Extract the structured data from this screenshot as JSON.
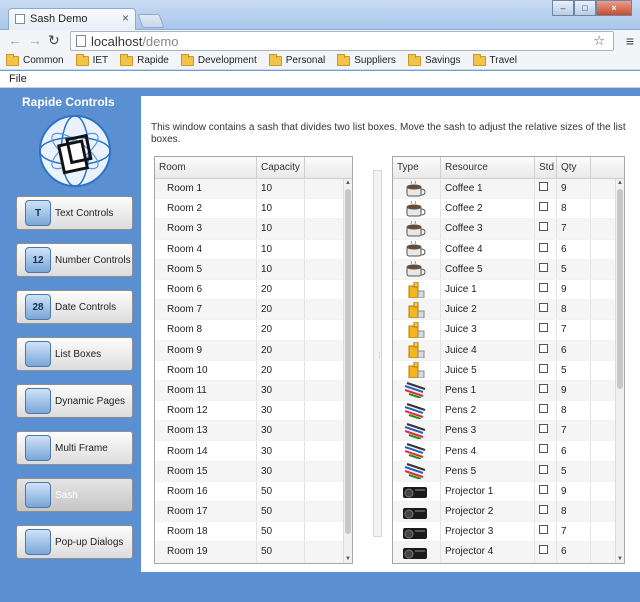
{
  "browser": {
    "tab_title": "Sash Demo",
    "url_host": "localhost",
    "url_path": "/demo",
    "bookmarks": [
      "Common",
      "IET",
      "Rapide",
      "Development",
      "Personal",
      "Suppliers",
      "Savings",
      "Travel"
    ]
  },
  "menubar": {
    "file": "File"
  },
  "sidebar": {
    "title": "Rapide Controls",
    "items": [
      {
        "label": "Text Controls",
        "icon": "T",
        "icon_name": "text-controls-icon"
      },
      {
        "label": "Number Controls",
        "icon": "12",
        "icon_name": "number-controls-icon"
      },
      {
        "label": "Date Controls",
        "icon": "28",
        "icon_name": "date-controls-icon"
      },
      {
        "label": "List Boxes",
        "icon": "",
        "icon_name": "list-boxes-icon"
      },
      {
        "label": "Dynamic Pages",
        "icon": "",
        "icon_name": "dynamic-pages-icon"
      },
      {
        "label": "Multi Frame",
        "icon": "",
        "icon_name": "multi-frame-icon"
      },
      {
        "label": "Sash",
        "icon": "",
        "icon_name": "sash-icon"
      },
      {
        "label": "Pop-up Dialogs",
        "icon": "",
        "icon_name": "popup-dialogs-icon"
      }
    ]
  },
  "main": {
    "description": "This window contains a sash that divides two list boxes. Move the sash to adjust the relative sizes of the list boxes.",
    "rooms": {
      "headers": [
        "Room",
        "Capacity"
      ],
      "rows": [
        [
          "Room 1",
          "10"
        ],
        [
          "Room 2",
          "10"
        ],
        [
          "Room 3",
          "10"
        ],
        [
          "Room 4",
          "10"
        ],
        [
          "Room 5",
          "10"
        ],
        [
          "Room 6",
          "20"
        ],
        [
          "Room 7",
          "20"
        ],
        [
          "Room 8",
          "20"
        ],
        [
          "Room 9",
          "20"
        ],
        [
          "Room 10",
          "20"
        ],
        [
          "Room 11",
          "30"
        ],
        [
          "Room 12",
          "30"
        ],
        [
          "Room 13",
          "30"
        ],
        [
          "Room 14",
          "30"
        ],
        [
          "Room 15",
          "30"
        ],
        [
          "Room 16",
          "50"
        ],
        [
          "Room 17",
          "50"
        ],
        [
          "Room 18",
          "50"
        ],
        [
          "Room 19",
          "50"
        ]
      ]
    },
    "resources": {
      "headers": [
        "Type",
        "Resource",
        "Std",
        "Qty"
      ],
      "rows": [
        {
          "type": "coffee",
          "resource": "Coffee 1",
          "qty": "9"
        },
        {
          "type": "coffee",
          "resource": "Coffee 2",
          "qty": "8"
        },
        {
          "type": "coffee",
          "resource": "Coffee 3",
          "qty": "7"
        },
        {
          "type": "coffee",
          "resource": "Coffee 4",
          "qty": "6"
        },
        {
          "type": "coffee",
          "resource": "Coffee 5",
          "qty": "5"
        },
        {
          "type": "juice",
          "resource": "Juice 1",
          "qty": "9"
        },
        {
          "type": "juice",
          "resource": "Juice 2",
          "qty": "8"
        },
        {
          "type": "juice",
          "resource": "Juice 3",
          "qty": "7"
        },
        {
          "type": "juice",
          "resource": "Juice 4",
          "qty": "6"
        },
        {
          "type": "juice",
          "resource": "Juice 5",
          "qty": "5"
        },
        {
          "type": "pens",
          "resource": "Pens 1",
          "qty": "9"
        },
        {
          "type": "pens",
          "resource": "Pens 2",
          "qty": "8"
        },
        {
          "type": "pens",
          "resource": "Pens 3",
          "qty": "7"
        },
        {
          "type": "pens",
          "resource": "Pens 4",
          "qty": "6"
        },
        {
          "type": "pens",
          "resource": "Pens 5",
          "qty": "5"
        },
        {
          "type": "projector",
          "resource": "Projector 1",
          "qty": "9"
        },
        {
          "type": "projector",
          "resource": "Projector 2",
          "qty": "8"
        },
        {
          "type": "projector",
          "resource": "Projector 3",
          "qty": "7"
        },
        {
          "type": "projector",
          "resource": "Projector 4",
          "qty": "6"
        }
      ]
    }
  },
  "colors": {
    "app_background": "#5a8fd2",
    "titlebar": "#a9c6ea"
  }
}
